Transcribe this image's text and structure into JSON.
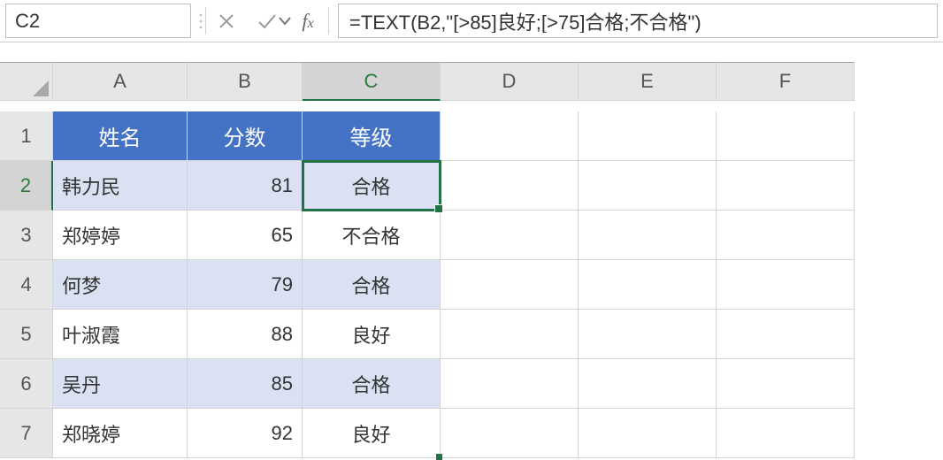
{
  "namebox": {
    "value": "C2"
  },
  "formula": {
    "value": "=TEXT(B2,\"[>85]良好;[>75]合格;不合格\")"
  },
  "columns": [
    "A",
    "B",
    "C",
    "D",
    "E",
    "F"
  ],
  "row_numbers": [
    "1",
    "2",
    "3",
    "4",
    "5",
    "6",
    "7"
  ],
  "selected": {
    "col_index": 2,
    "row_index": 1,
    "cell_ref": "C2"
  },
  "table": {
    "headers": {
      "name": "姓名",
      "score": "分数",
      "grade": "等级"
    },
    "rows": [
      {
        "name": "韩力民",
        "score": "81",
        "grade": "合格"
      },
      {
        "name": "郑婷婷",
        "score": "65",
        "grade": "不合格"
      },
      {
        "name": "何梦",
        "score": "79",
        "grade": "合格"
      },
      {
        "name": "叶淑霞",
        "score": "88",
        "grade": "良好"
      },
      {
        "name": "吴丹",
        "score": "85",
        "grade": "合格"
      },
      {
        "name": "郑晓婷",
        "score": "92",
        "grade": "良好"
      }
    ]
  },
  "chart_data": {
    "type": "table",
    "title": "",
    "columns": [
      "姓名",
      "分数",
      "等级"
    ],
    "rows": [
      [
        "韩力民",
        81,
        "合格"
      ],
      [
        "郑婷婷",
        65,
        "不合格"
      ],
      [
        "何梦",
        79,
        "合格"
      ],
      [
        "叶淑霞",
        88,
        "良好"
      ],
      [
        "吴丹",
        85,
        "合格"
      ],
      [
        "郑晓婷",
        92,
        "良好"
      ]
    ]
  },
  "colors": {
    "accent": "#217346",
    "table_header": "#4472c4",
    "band": "#d9e1f2"
  }
}
